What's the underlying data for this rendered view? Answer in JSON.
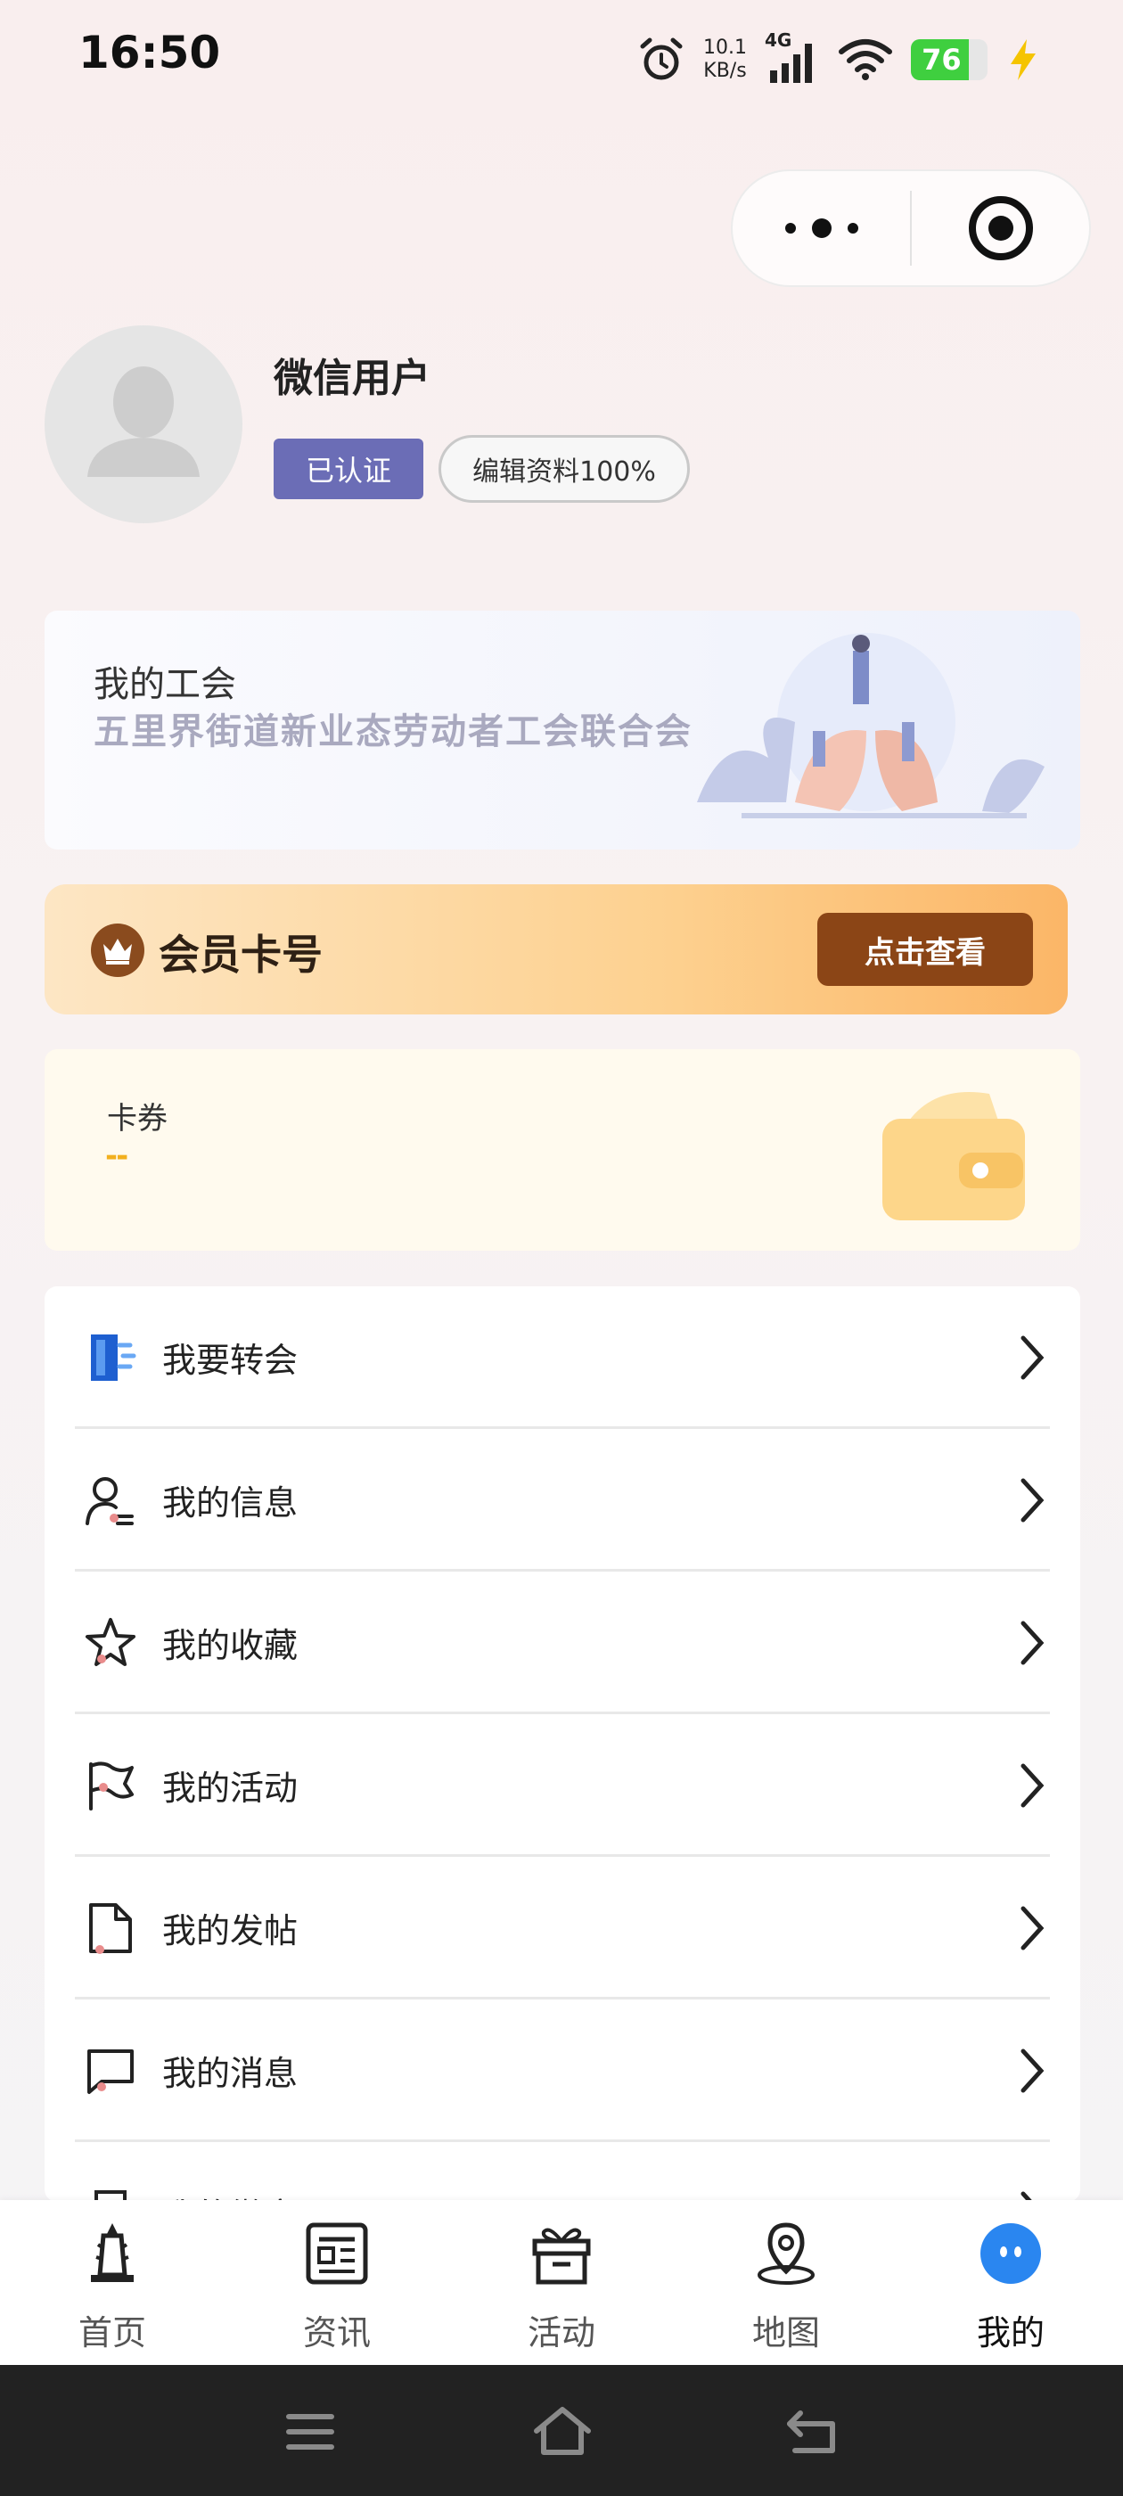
{
  "status_bar": {
    "time": "16:50",
    "net_speed_value": "10.1",
    "net_speed_unit": "KB/s",
    "network": "4G",
    "battery": "76"
  },
  "profile": {
    "username": "微信用户",
    "verified_label": "已认证",
    "edit_label": "编辑资料100%"
  },
  "union": {
    "title": "我的工会",
    "name": "五里界街道新业态劳动者工会联合会"
  },
  "membership": {
    "label": "会员卡号",
    "button": "点击查看"
  },
  "coupons": {
    "title": "卡券",
    "value": "--"
  },
  "menu": {
    "items": [
      {
        "label": "我要转会",
        "icon": "transfer-door-icon"
      },
      {
        "label": "我的信息",
        "icon": "user-info-icon"
      },
      {
        "label": "我的收藏",
        "icon": "star-icon"
      },
      {
        "label": "我的活动",
        "icon": "flag-icon"
      },
      {
        "label": "我的发帖",
        "icon": "document-icon"
      },
      {
        "label": "我的消息",
        "icon": "message-icon"
      },
      {
        "label": "我的徽章",
        "icon": "badge-icon"
      }
    ]
  },
  "tabbar": {
    "tabs": [
      {
        "label": "首页",
        "icon": "tower-icon"
      },
      {
        "label": "资讯",
        "icon": "news-icon"
      },
      {
        "label": "活动",
        "icon": "gift-icon"
      },
      {
        "label": "地图",
        "icon": "map-pin-icon"
      },
      {
        "label": "我的",
        "icon": "profile-face-icon"
      }
    ],
    "active": "我的"
  },
  "colors": {
    "accent_blue": "#2a86f0",
    "verified_purple": "#6b6db6",
    "member_brown": "#8b4516",
    "coupon_gold": "#f2b01e"
  }
}
